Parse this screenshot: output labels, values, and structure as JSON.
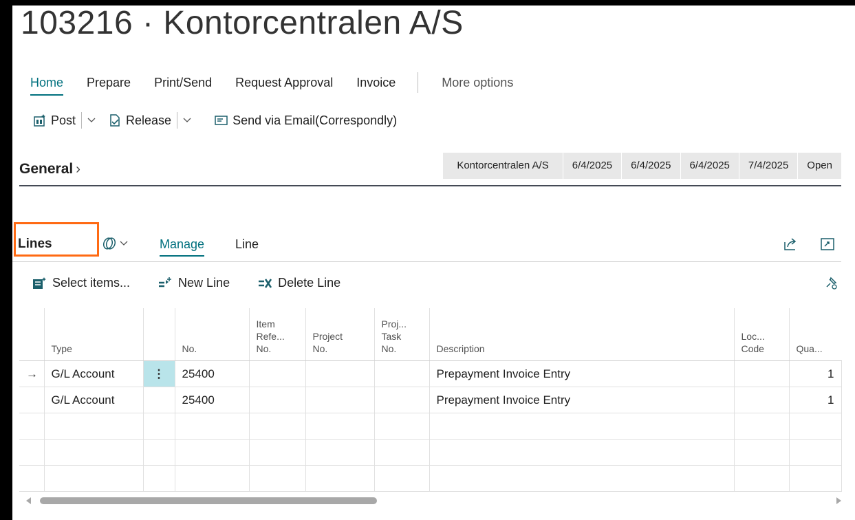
{
  "title": "103216 · Kontorcentralen A/S",
  "tabs": [
    "Home",
    "Prepare",
    "Print/Send",
    "Request Approval",
    "Invoice"
  ],
  "more_options": "More options",
  "actions": {
    "post": "Post",
    "release": "Release",
    "send_email": "Send via Email(Correspondly)"
  },
  "general": {
    "title": "General",
    "summary": [
      "Kontorcentralen A/S",
      "6/4/2025",
      "6/4/2025",
      "6/4/2025",
      "7/4/2025",
      "Open"
    ]
  },
  "lines": {
    "title": "Lines",
    "tabs": {
      "manage": "Manage",
      "line": "Line"
    },
    "actions": {
      "select_items": "Select items...",
      "new_line": "New Line",
      "delete_line": "Delete Line"
    }
  },
  "grid": {
    "headers": {
      "type": "Type",
      "no": "No.",
      "item_ref": [
        "Item",
        "Refe...",
        "No."
      ],
      "project": [
        "Project",
        "No."
      ],
      "proj_task": [
        "Proj...",
        "Task",
        "No."
      ],
      "description": "Description",
      "loc": [
        "Loc...",
        "Code"
      ],
      "qty": "Qua..."
    },
    "rows": [
      {
        "type": "G/L Account",
        "no": "25400",
        "description": "Prepayment Invoice Entry",
        "qty": "1"
      },
      {
        "type": "G/L Account",
        "no": "25400",
        "description": "Prepayment Invoice Entry",
        "qty": "1"
      }
    ]
  },
  "colors": {
    "accent": "#00707e",
    "highlight_box": "#ff6a13",
    "selected_cell": "#b9e4ea"
  }
}
